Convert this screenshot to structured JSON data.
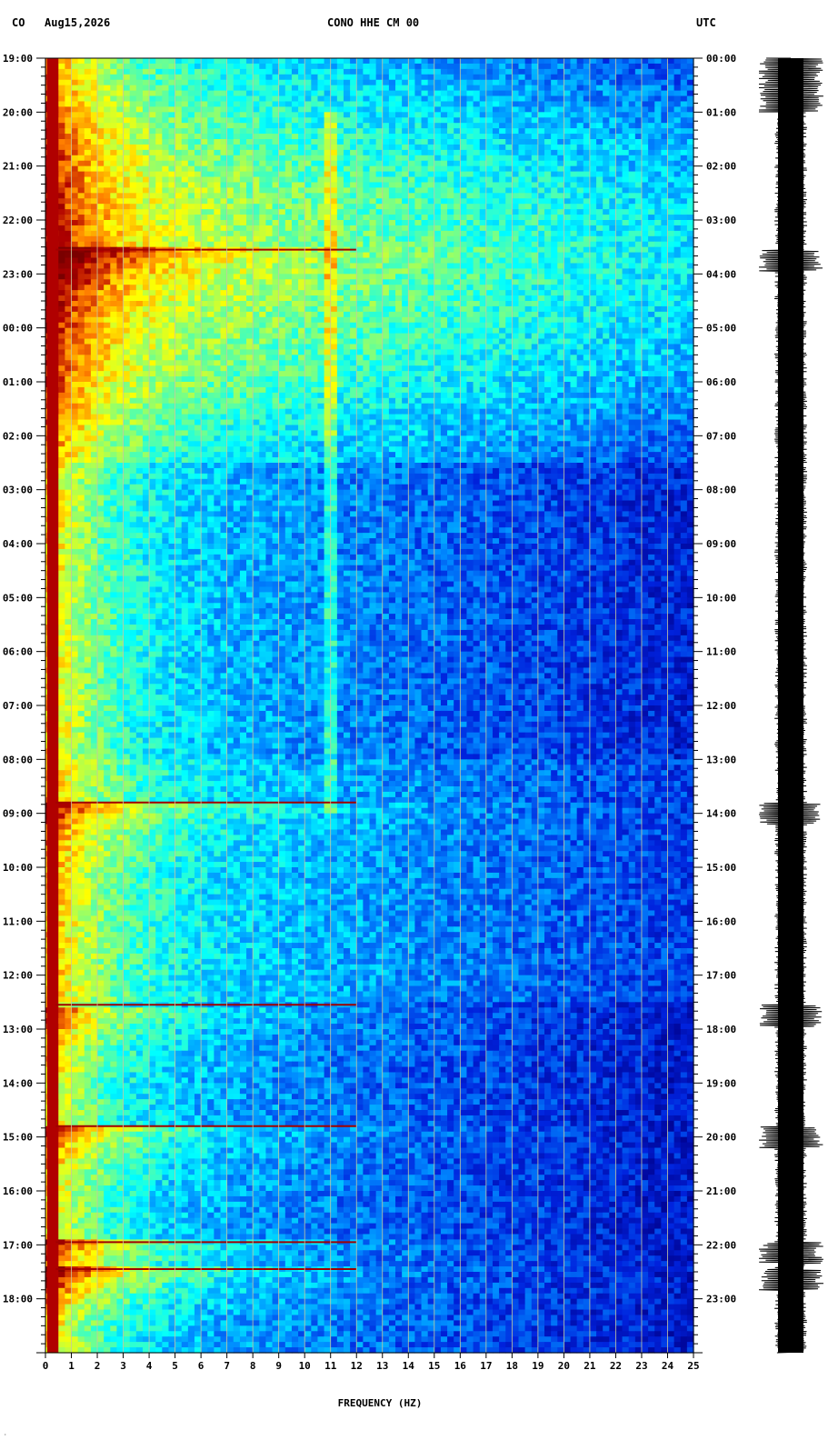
{
  "header": {
    "network": "CO",
    "date": "Aug15,2026",
    "channel": "CONO HHE CM 00",
    "timezone": "UTC"
  },
  "corner_mark": "·",
  "chart_data": {
    "type": "heatmap",
    "title": "CONO HHE CM 00",
    "xlabel": "FREQUENCY (HZ)",
    "xlim": [
      0,
      25
    ],
    "x_ticks": [
      "0",
      "1",
      "2",
      "3",
      "4",
      "5",
      "6",
      "7",
      "8",
      "9",
      "10",
      "11",
      "12",
      "13",
      "14",
      "15",
      "16",
      "17",
      "18",
      "19",
      "20",
      "21",
      "22",
      "23",
      "24",
      "25"
    ],
    "left_ticks": [
      "19:00",
      "20:00",
      "21:00",
      "22:00",
      "23:00",
      "00:00",
      "01:00",
      "02:00",
      "03:00",
      "04:00",
      "05:00",
      "06:00",
      "07:00",
      "08:00",
      "09:00",
      "10:00",
      "11:00",
      "12:00",
      "13:00",
      "14:00",
      "15:00",
      "16:00",
      "17:00",
      "18:00"
    ],
    "right_ticks": [
      "00:00",
      "01:00",
      "02:00",
      "03:00",
      "04:00",
      "05:00",
      "06:00",
      "07:00",
      "08:00",
      "09:00",
      "10:00",
      "11:00",
      "12:00",
      "13:00",
      "14:00",
      "15:00",
      "16:00",
      "17:00",
      "18:00",
      "19:00",
      "20:00",
      "21:00",
      "22:00",
      "23:00"
    ],
    "duration_hours": 24,
    "grid": true,
    "colormap": [
      "#00008b",
      "#0022dd",
      "#0088ff",
      "#00ffff",
      "#7fff7f",
      "#ffff00",
      "#ff8000",
      "#b00000",
      "#7a0000"
    ],
    "events_hours": [
      3.55,
      13.8,
      17.55,
      19.8,
      21.95,
      22.45
    ],
    "narrow_band_hz": 11.0,
    "waveform_color": "#000000"
  }
}
